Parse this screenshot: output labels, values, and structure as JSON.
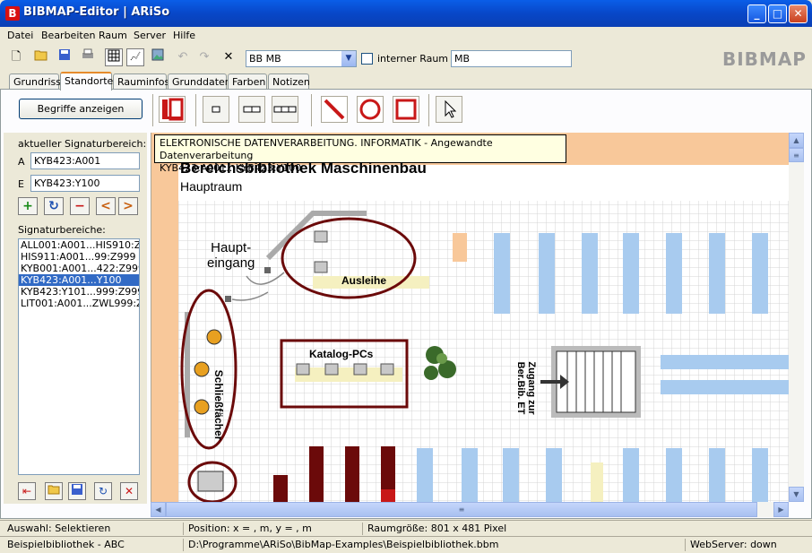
{
  "window": {
    "logo_letter": "B",
    "title": "BIBMAP-Editor  |  ARiSo",
    "btn_min": "_",
    "btn_max": "□",
    "btn_close": "✕"
  },
  "menu": [
    "Datei",
    "Bearbeiten",
    "Raum",
    "Server",
    "Hilfe"
  ],
  "toolbar": {
    "room_select": "BB MB",
    "interner_raum_label": "interner Raum",
    "room_code": "MB",
    "logo": "BIBMAP"
  },
  "tabs": [
    "Grundriss",
    "Standorte",
    "Rauminfos",
    "Grunddaten",
    "Farben",
    "Notizen"
  ],
  "active_tab": "Standorte",
  "ribbon": {
    "begriffe_button": "Begriffe anzeigen"
  },
  "left": {
    "aktueller_label": "aktueller Signaturbereich:",
    "a_label": "A",
    "a_value": "KYB423:A001",
    "e_label": "E",
    "e_value": "KYB423:Y100",
    "signaturbereiche_label": "Signaturbereiche:",
    "list": [
      "ALL001:A001...HIS910:Z999",
      "HIS911:A001...99:Z999",
      "KYB001:A001...422:Z999",
      "KYB423:A001...Y100",
      "KYB423:Y101...999:Z999",
      "LIT001:A001...ZWL999:Z999"
    ],
    "selected": "KYB423:A001...Y100"
  },
  "tooltip": {
    "line1": "ELEKTRONISCHE DATENVERARBEITUNG. INFORMATIK - Angewandte Datenverarbeitung",
    "line2": "KYB423:A001...KYB423:Y100"
  },
  "map": {
    "title": "Bereichsbibliothek Maschinenbau",
    "subtitle": "Hauptraum",
    "haupteingang_1": "Haupt-",
    "haupteingang_2": "eingang",
    "ausleihe": "Ausleihe",
    "katalog": "Katalog-PCs",
    "schliessfaecher": "Schließfächer",
    "zugang_1": "Zugang zur",
    "zugang_2": "Ber.Bib. ET"
  },
  "status": {
    "auswahl": "Auswahl: Selektieren",
    "position": "Position: x =    , m, y =    , m",
    "raumgroesse": "Raumgröße: 801 x 481 Pixel",
    "bibliothek": "Beispielbibliothek - ABC",
    "path": "D:\\Programme\\ARiSo\\BibMap-Examples\\Beispielbibliothek.bbm",
    "webserver": "WebServer: down"
  },
  "colors": {
    "accent_red": "#c81818",
    "dark_red": "#6b0a0a",
    "shelf_blue": "#a8cbef",
    "floor_orange": "#f8c89a",
    "light_yellow": "#f5f0c0"
  }
}
